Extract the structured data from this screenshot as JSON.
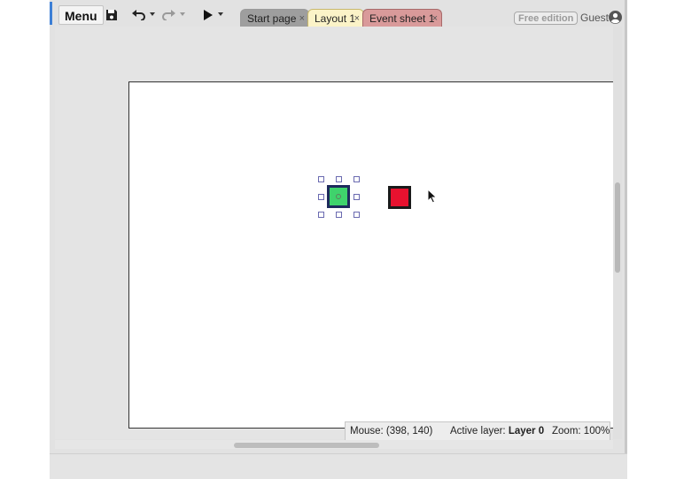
{
  "toolbar": {
    "menu_label": "Menu",
    "icons": [
      "save-icon",
      "undo-icon",
      "redo-icon",
      "play-icon"
    ]
  },
  "tabs": [
    {
      "label": "Start page",
      "state": "inactive"
    },
    {
      "label": "Layout 1",
      "state": "active"
    },
    {
      "label": "Event sheet 1",
      "state": "inactive"
    }
  ],
  "tab_close_glyph": "×",
  "account": {
    "edition_label": "Free edition",
    "user_label": "Guest",
    "icon": "user-avatar-icon"
  },
  "canvas": {
    "objects": [
      {
        "name": "green-square-sprite",
        "color": "#3fd36c",
        "border": "#1d2a5c",
        "selected": true
      },
      {
        "name": "red-square-sprite",
        "color": "#e8122f",
        "border": "#1a1a1a",
        "selected": false
      }
    ]
  },
  "status": {
    "mouse_label": "Mouse:",
    "mouse_value": "(398, 140)",
    "layer_label": "Active layer:",
    "layer_value": "Layer 0",
    "zoom_label": "Zoom:",
    "zoom_value": "100%"
  },
  "colors": {
    "accent": "#3d7fd6",
    "active_tab": "#fbf3c8",
    "event_tab": "#d99a9a",
    "inactive_tab": "#9e9e9e"
  }
}
